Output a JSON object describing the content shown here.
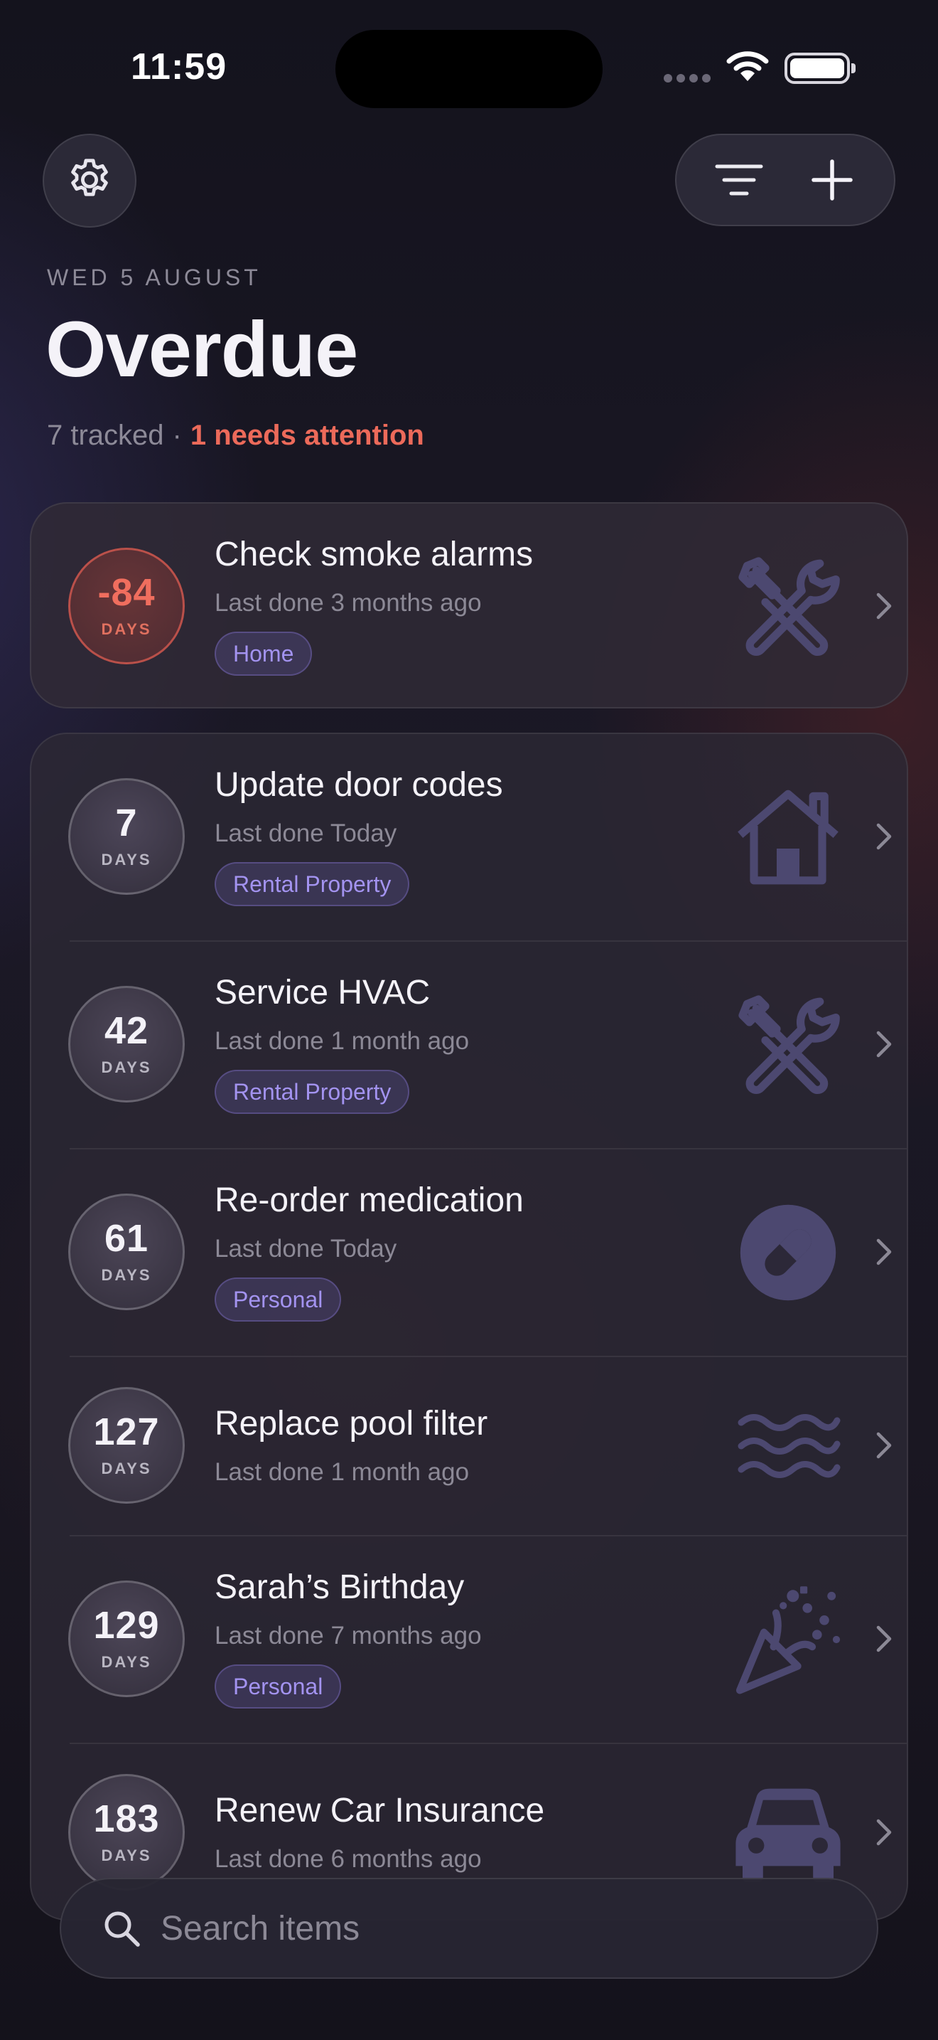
{
  "status_bar": {
    "time": "11:59"
  },
  "header": {
    "date": "WED 5 AUGUST",
    "title": "Overdue",
    "tracked": "7 tracked",
    "separator": "·",
    "attention": "1 needs attention"
  },
  "colors": {
    "accent_red": "#ec6a5a",
    "tag_purple": "#a393f0",
    "background": "#16141f"
  },
  "overdue_item": {
    "days": "-84",
    "unit": "DAYS",
    "title": "Check smoke alarms",
    "last_done": "Last done 3 months ago",
    "tag": "Home",
    "icon": "tools-icon"
  },
  "items": [
    {
      "days": "7",
      "unit": "DAYS",
      "title": "Update door codes",
      "last_done": "Last done Today",
      "tag": "Rental Property",
      "icon": "house-icon"
    },
    {
      "days": "42",
      "unit": "DAYS",
      "title": "Service HVAC",
      "last_done": "Last done 1 month ago",
      "tag": "Rental Property",
      "icon": "tools-icon"
    },
    {
      "days": "61",
      "unit": "DAYS",
      "title": "Re-order medication",
      "last_done": "Last done Today",
      "tag": "Personal",
      "icon": "pill-icon"
    },
    {
      "days": "127",
      "unit": "DAYS",
      "title": "Replace pool filter",
      "last_done": "Last done 1 month ago",
      "tag": "",
      "icon": "water-waves-icon"
    },
    {
      "days": "129",
      "unit": "DAYS",
      "title": "Sarah’s Birthday",
      "last_done": "Last done 7 months ago",
      "tag": "Personal",
      "icon": "party-popper-icon"
    },
    {
      "days": "183",
      "unit": "DAYS",
      "title": "Renew Car Insurance",
      "last_done": "Last done 6 months ago",
      "tag": "",
      "icon": "car-icon"
    }
  ],
  "search": {
    "placeholder": "Search items",
    "value": ""
  }
}
